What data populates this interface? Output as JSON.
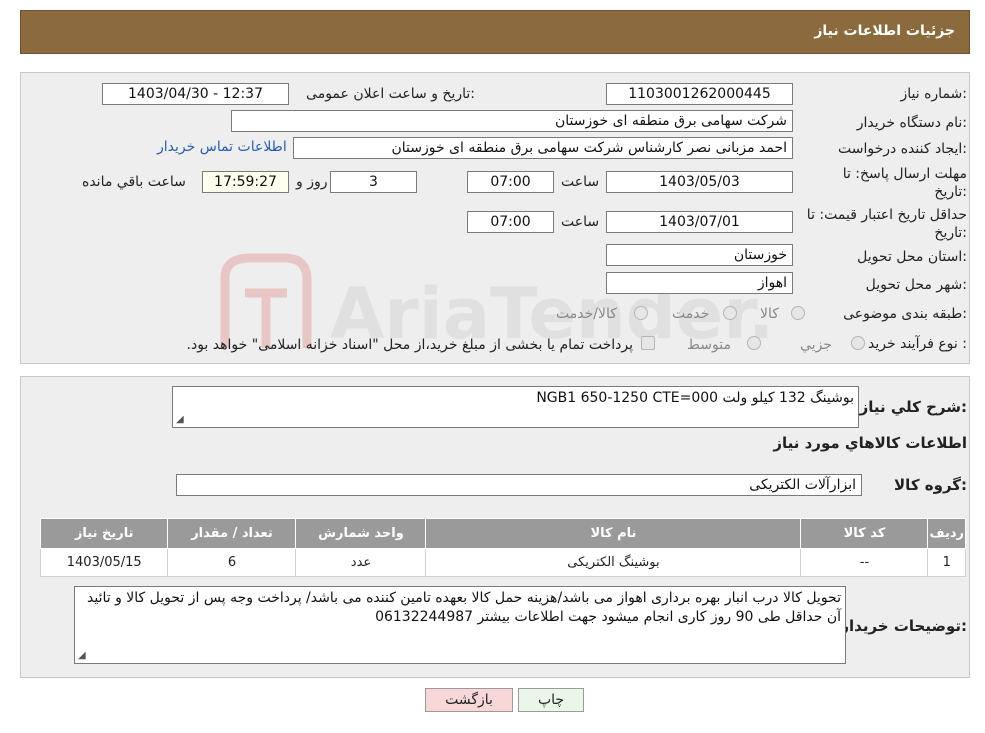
{
  "header": {
    "title": "جزئیات اطلاعات نیاز"
  },
  "form": {
    "need_number_label": "شماره نیاز:",
    "need_number": "1103001262000445",
    "announce_label": "تاریخ و ساعت اعلان عمومی:",
    "announce_value": "1403/04/30 - 12:37",
    "buyer_org_label": "نام دستگاه خریدار:",
    "buyer_org": "شرکت سهامی برق منطقه ای خوزستان",
    "creator_label": "ایجاد کننده درخواست:",
    "creator": "احمد مزبانی نصر کارشناس شرکت سهامی برق منطقه ای خوزستان",
    "contact_link": "اطلاعات تماس خریدار",
    "deadline_label_1": "مهلت ارسال پاسخ: تا",
    "deadline_label_2": "تاریخ:",
    "deadline_date": "1403/05/03",
    "time_label": "ساعت",
    "deadline_time": "07:00",
    "days_value": "3",
    "days_label": "روز و",
    "remaining_time": "17:59:27",
    "remaining_label": "ساعت باقي مانده",
    "validity_label_1": "حداقل تاریخ اعتبار قیمت: تا",
    "validity_label_2": "تاریخ:",
    "validity_date": "1403/07/01",
    "validity_time": "07:00",
    "province_label": "استان محل تحویل:",
    "province": "خوزستان",
    "city_label": "شهر محل تحویل:",
    "city": "اهواز",
    "category_label": "طبقه بندی موضوعی:",
    "category_options": [
      "کالا",
      "خدمت",
      "کالا/خدمت"
    ],
    "process_label": "نوع فرآیند خرید :",
    "process_options": [
      "جزيي",
      "متوسط"
    ],
    "payment_note": "پرداخت تمام یا بخشی از مبلغ خرید،از محل \"اسناد خزانه اسلامی\" خواهد بود."
  },
  "details": {
    "summary_label": "شرح كلي نياز:",
    "summary": "بوشینگ 132 کیلو ولت NGB1 650-1250 CTE=000",
    "goods_info_title": "اطلاعات كالاهاي مورد نياز",
    "goods_group_label": "گروه كالا:",
    "goods_group": "ابزارآلات الکتریکی",
    "table": {
      "headers": [
        "رديف",
        "کد کالا",
        "نام کالا",
        "واحد شمارش",
        "تعداد / مقدار",
        "تاریخ نیاز"
      ],
      "rows": [
        [
          "1",
          "--",
          "بوشینگ الکتریکی",
          "عدد",
          "6",
          "1403/05/15"
        ]
      ]
    },
    "buyer_notes_label": "توضیحات خریدار:",
    "buyer_notes": "تحویل کالا درب انبار بهره برداری اهواز می باشد/هزینه حمل کالا بعهده تامین کننده می باشد/ پرداخت وجه پس از تحویل کالا و تائید آن حداقل طی 90 روز کاری انجام میشود  جهت اطلاعات بیشتر 06132244987"
  },
  "buttons": {
    "print": "چاپ",
    "back": "بازگشت"
  },
  "watermark": {
    "text": "AriaTender.neT"
  },
  "colors": {
    "header": "#8b6a3e",
    "table_header": "#9a9a9a",
    "back_button": "#f7d7d7",
    "print_button": "#eaf7e8"
  }
}
